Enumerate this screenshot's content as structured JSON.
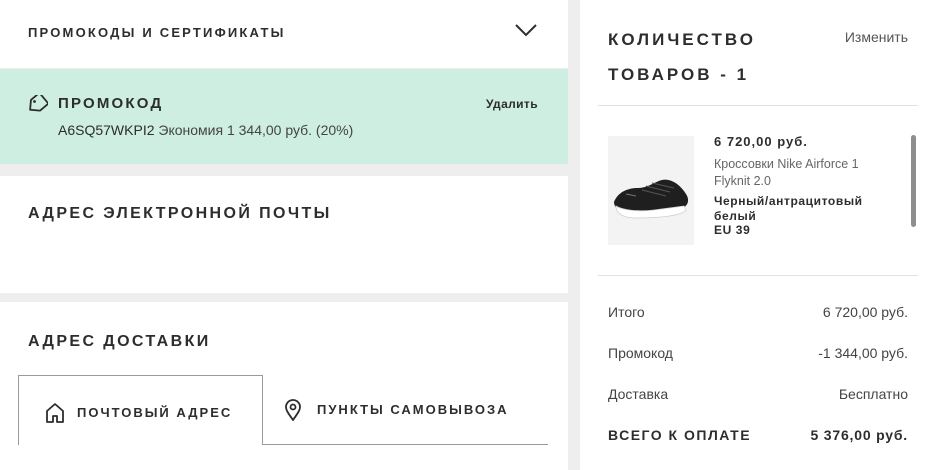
{
  "promo_section": {
    "title": "ПРОМОКОДЫ И СЕРТИФИКАТЫ",
    "applied": {
      "label": "ПРОМОКОД",
      "remove": "Удалить",
      "code": "A6SQ57WKPI2",
      "saving": "Экономия 1 344,00 руб. (20%)"
    }
  },
  "email_section": {
    "title": "АДРЕС ЭЛЕКТРОННОЙ ПОЧТЫ"
  },
  "delivery_section": {
    "title": "АДРЕС ДОСТАВКИ",
    "tabs": [
      {
        "label": "ПОЧТОВЫЙ АДРЕС",
        "icon": "home-icon",
        "active": true
      },
      {
        "label": "ПУНКТЫ САМОВЫВОЗА",
        "icon": "location-pin-icon",
        "active": false
      }
    ]
  },
  "cart": {
    "title": "КОЛИЧЕСТВО ТОВАРОВ - 1",
    "edit": "Изменить",
    "item": {
      "price": "6 720,00 руб.",
      "name": "Кроссовки Nike Airforce 1 Flyknit 2.0",
      "color": "Черный/антрацитовый белый",
      "size": "EU 39"
    },
    "summary": {
      "subtotal_label": "Итого",
      "subtotal_value": "6 720,00 руб.",
      "promo_label": "Промокод",
      "promo_value": "-1 344,00 руб.",
      "shipping_label": "Доставка",
      "shipping_value": "Бесплатно",
      "total_label": "ВСЕГО К ОПЛАТЕ",
      "total_value": "5 376,00 руб."
    }
  }
}
